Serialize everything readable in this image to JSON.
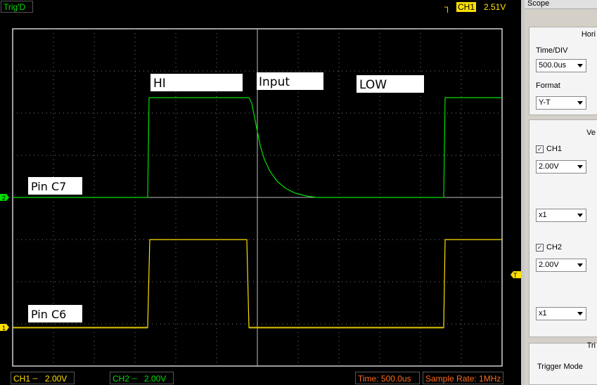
{
  "status": {
    "trig_state": "Trig'D"
  },
  "trigger": {
    "channel": "CH1",
    "level": "2.51V",
    "edge_icon": "rising-edge-icon"
  },
  "annotations": {
    "hi": "HI",
    "input": "Input",
    "low": "LOW",
    "pin_c7": "Pin C7",
    "pin_c6": "Pin C6"
  },
  "markers": {
    "ch2": "2",
    "ch1": "1",
    "trigger": "T"
  },
  "bottom": {
    "ch1_label": "CH1",
    "ch1_volts": "2.00V",
    "ch2_label": "CH2",
    "ch2_volts": "2.00V",
    "time": "Time: 500.0us",
    "sample_rate": "Sample Rate: 1MHz"
  },
  "panel": {
    "title": "Scope",
    "horizontal_header": "Hori",
    "timediv_label": "Time/DIV",
    "timediv_value": "500.0us",
    "format_label": "Format",
    "format_value": "Y-T",
    "vertical_header": "Ve",
    "ch1_label": "CH1",
    "ch1_volts": "2.00V",
    "ch1_probe": "x1",
    "ch2_label": "CH2",
    "ch2_volts": "2.00V",
    "ch2_probe": "x1",
    "trigger_header": "Tri",
    "trigger_mode_label": "Trigger Mode"
  },
  "colors": {
    "ch1": "#ffe000",
    "ch2": "#00e000",
    "grid": "#7a7a7a",
    "panel_bg": "#d4d0c8"
  }
}
